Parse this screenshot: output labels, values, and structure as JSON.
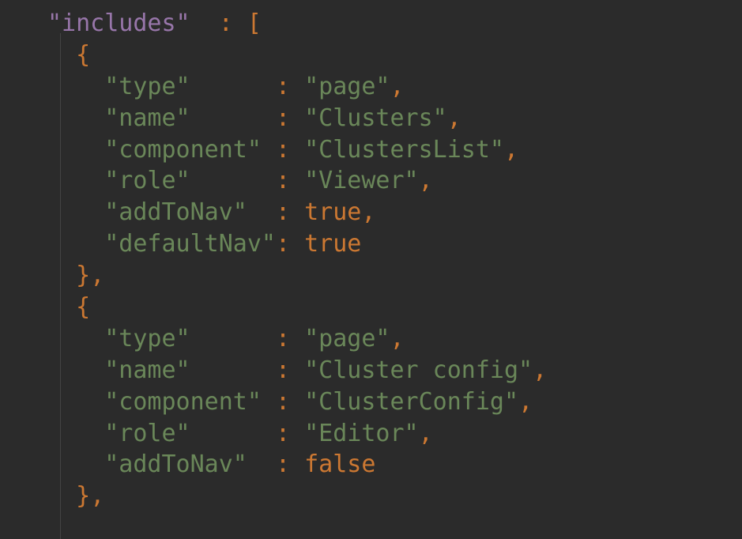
{
  "code": {
    "key_includes": "\"includes\"",
    "open_bracket": "[",
    "open_brace": "{",
    "close_brace": "}",
    "colon": ":",
    "comma": ",",
    "key_type": "\"type\"",
    "key_name": "\"name\"",
    "key_component": "\"component\"",
    "key_role": "\"role\"",
    "key_addToNav": "\"addToNav\"",
    "key_defaultNav": "\"defaultNav\"",
    "val_page": "\"page\"",
    "val_clusters": "\"Clusters\"",
    "val_clusterslist": "\"ClustersList\"",
    "val_viewer": "\"Viewer\"",
    "val_clusterconfig_name": "\"Cluster config\"",
    "val_clusterconfig_comp": "\"ClusterConfig\"",
    "val_editor": "\"Editor\"",
    "val_true": "true",
    "val_false": "false"
  }
}
